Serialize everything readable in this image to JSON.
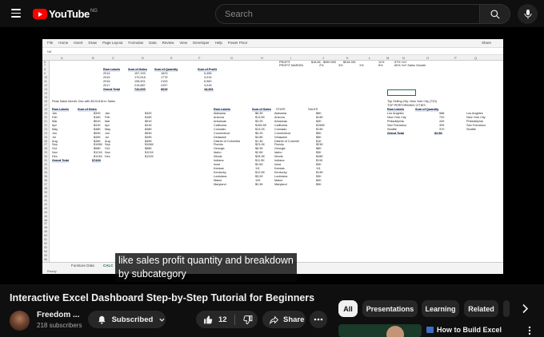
{
  "header": {
    "logo_text": "YouTube",
    "logo_country": "NG",
    "search_placeholder": "Search"
  },
  "video": {
    "caption_line1": "like sales profit quantity and breakdown",
    "caption_line2": "by subcategory"
  },
  "excel": {
    "menu": [
      "File",
      "Home",
      "Insert",
      "Draw",
      "Page Layout",
      "Formulas",
      "Data",
      "Review",
      "View",
      "Developer",
      "Help",
      "Power Pivot"
    ],
    "share": "Share",
    "name_box": "N8",
    "columns": [
      "A",
      "B",
      "C",
      "D",
      "E",
      "F",
      "G",
      "H",
      "I",
      "J",
      "K",
      "L",
      "M",
      "N",
      "O",
      "P",
      "Q"
    ],
    "top_kpis": {
      "profit_label": "PROFIT",
      "profit_values": [
        "$18.5K",
        "$959.953",
        "$918.391"
      ],
      "margin_label": "PROFIT MARGIN",
      "margin_values": [
        "2%",
        "3%",
        "1%"
      ],
      "arrow1": "11%",
      "kpi1": "57% YoY",
      "arrow2": "6%",
      "kpi2": "60% YoY Sales Growth"
    },
    "year_table": {
      "headers": [
        "Row Labels",
        "Sum of Sales",
        "Sum of Quantity",
        "Sum of Profit"
      ],
      "rows": [
        [
          "2014",
          "157,193",
          "1623",
          "5,458"
        ],
        [
          "2015",
          "170,518",
          "1775",
          "3,015"
        ],
        [
          "2016",
          "198,901",
          "2193",
          "6,960"
        ],
        [
          "2017",
          "215,887",
          "2437",
          "3,018"
        ]
      ],
      "total": [
        "Grand Total",
        "742,000",
        "8028",
        "18,451"
      ]
    },
    "peak_note": "Peak Sales Month: Dec with $123,818 in Sales",
    "month_table": {
      "headers": [
        "Row Labels",
        "Sum of Sales"
      ],
      "rows": [
        [
          "Jan",
          "$32K",
          "Jan",
          "$32K"
        ],
        [
          "Feb",
          "$16K",
          "Feb",
          "$16K"
        ],
        [
          "Mar",
          "$51K",
          "Mar",
          "$51K"
        ],
        [
          "Apr",
          "$41K",
          "Apr",
          "$41K"
        ],
        [
          "May",
          "$48K",
          "May",
          "$48K"
        ],
        [
          "Jun",
          "$53K",
          "Jun",
          "$53K"
        ],
        [
          "Jul",
          "$49K",
          "Jul",
          "$49K"
        ],
        [
          "Aug",
          "$45K",
          "Aug",
          "$45K"
        ],
        [
          "Sep",
          "$106K",
          "Sep",
          "$106K"
        ],
        [
          "Oct",
          "$58K",
          "Oct",
          "$58K"
        ],
        [
          "Nov",
          "$121K",
          "Nov",
          "$121K"
        ],
        [
          "Dec",
          "$124K",
          "Dec",
          "$122K"
        ]
      ],
      "total": [
        "Grand Total",
        "$742K"
      ]
    },
    "state_table": {
      "headers": [
        "Row Labels",
        "Sum of Sales",
        "STATE",
        "SALES"
      ],
      "rows": [
        [
          "Alabama",
          "$6.3K",
          "Alabama",
          "$6K"
        ],
        [
          "Arizona",
          "$13.5K",
          "Arizona",
          "$14K"
        ],
        [
          "Arkansas",
          "$3.2K",
          "Arkansas",
          "$3K"
        ],
        [
          "California",
          "$156.5K",
          "California",
          "$156K"
        ],
        [
          "Colorado",
          "$13.2K",
          "Colorado",
          "$13K"
        ],
        [
          "Connecticut",
          "$5.2K",
          "Connecticut",
          "$5K"
        ],
        [
          "Delaware",
          "$4.8K",
          "Delaware",
          "$5K"
        ],
        [
          "District of Columbia",
          "$1.3K",
          "District of Columbi",
          "$1K"
        ],
        [
          "Florida",
          "$23.0K",
          "Florida",
          "$23K"
        ],
        [
          "Georgia",
          "$8.3K",
          "Georgia",
          "$8K"
        ],
        [
          "Idaho",
          "$2.6K",
          "Idaho",
          "$3K"
        ],
        [
          "Illinois",
          "$28.3K",
          "Illinois",
          "$28K"
        ],
        [
          "Indiana",
          "$11.5K",
          "Indiana",
          "$11K"
        ],
        [
          "Iowa",
          "$2.6K",
          "Iowa",
          "$3K"
        ],
        [
          "Kansas",
          "111",
          "Kansas",
          "111"
        ],
        [
          "Kentucky",
          "$12.5K",
          "Kentucky",
          "$13K"
        ],
        [
          "Louisiana",
          "$3.0K",
          "Louisiana",
          "$3K"
        ],
        [
          "Maine",
          "109",
          "Maine",
          "$0K"
        ],
        [
          "Maryland",
          "$9.3K",
          "Maryland",
          "$9K"
        ]
      ]
    },
    "city_note": "Top Selling City: New York City (720)",
    "city_subnote": "TOP PERFORMING CITIES",
    "city_table": {
      "headers": [
        "Row Labels",
        "Sum of Quantity"
      ],
      "rows": [
        [
          "Los Angeles",
          "588",
          "Los Angeles"
        ],
        [
          "New York City",
          "720",
          "New York City"
        ],
        [
          "Philadelphia",
          "449",
          "Philadelphia"
        ],
        [
          "San Francisco",
          "399",
          "San Francisco"
        ],
        [
          "Seattle",
          "370",
          "Seattle"
        ]
      ],
      "total": [
        "Grand Total",
        "$2.5K"
      ]
    },
    "sheet_tabs": [
      "Furniture Data",
      "CALC"
    ],
    "status": "Ready"
  },
  "metadata": {
    "title": "Interactive Excel Dashboard Step-by-Step Tutorial for Beginners",
    "channel": "Freedom ...",
    "subscribers": "218 subscribers",
    "subscribed_label": "Subscribed",
    "likes": "12",
    "share_label": "Share"
  },
  "chips": {
    "items": [
      "All",
      "Presentations",
      "Learning",
      "Related"
    ]
  },
  "recommendation": {
    "title": "How to Build Excel"
  },
  "colors": {
    "youtube_red": "#ff0000",
    "background": "#0f0f0f",
    "excel_green": "#1e7145",
    "pivot_header": "#dbe5f5"
  }
}
